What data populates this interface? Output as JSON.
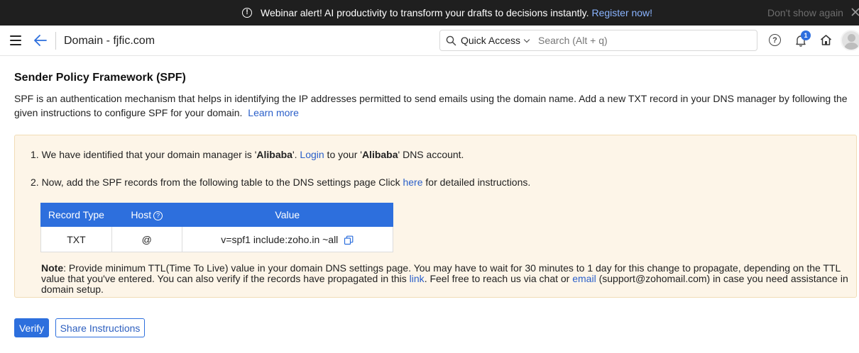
{
  "banner": {
    "message": "Webinar alert! AI productivity to transform your drafts to decisions instantly.",
    "register_label": "Register now!",
    "dont_show_label": "Don't show again",
    "icons": [
      "alert-circle-icon",
      "close-icon"
    ]
  },
  "header": {
    "title": "Domain - fjfic.com",
    "quick_access_label": "Quick Access",
    "search_placeholder": "Search (Alt + q)",
    "notification_count": "1",
    "help_glyph": "?",
    "icons": [
      "menu-icon",
      "back-arrow-icon",
      "search-icon",
      "chevron-down-icon",
      "help-icon",
      "bell-icon",
      "home-icon",
      "avatar"
    ]
  },
  "spf": {
    "title": "Sender Policy Framework (SPF)",
    "description": "SPF is an authentication mechanism that helps in identifying the IP addresses permitted to send emails using the domain name. Add a new TXT record in your DNS manager by following the given instructions to configure SPF for your domain.",
    "learn_more": "Learn more",
    "step1": {
      "prefix": "1. We have identified that your domain manager is '",
      "provider": "Alibaba",
      "mid": "'. ",
      "login": "Login",
      "after_login": " to your '",
      "provider2": "Alibaba",
      "suffix": "' DNS account."
    },
    "step2": {
      "prefix": "2. Now, add the SPF records from the following table to the DNS settings page Click ",
      "here": "here",
      "suffix": " for detailed instructions."
    },
    "table": {
      "headers": {
        "type": "Record Type",
        "host": "Host",
        "value": "Value"
      },
      "row": {
        "type": "TXT",
        "host": "@",
        "value": "v=spf1 include:zoho.in ~all"
      }
    },
    "note": {
      "label": "Note",
      "text1": ": Provide minimum TTL(Time To Live) value in your domain DNS settings page. You may have to wait for 30 minutes to 1 day for this change to propagate, depending on the TTL value that you've entered. You can also verify if the records have propagated in this ",
      "link": "link",
      "text2": ". Feel free to reach us via chat or ",
      "email": "email",
      "text3": " (support@zohomail.com) in case you need assistance in domain setup."
    },
    "verify_label": "Verify",
    "share_label": "Share Instructions"
  },
  "colors": {
    "banner_bg": "#1f1f1f",
    "accent": "#2d6fdd",
    "link": "#2a5fc9",
    "panel_bg": "#fdf5e8"
  }
}
